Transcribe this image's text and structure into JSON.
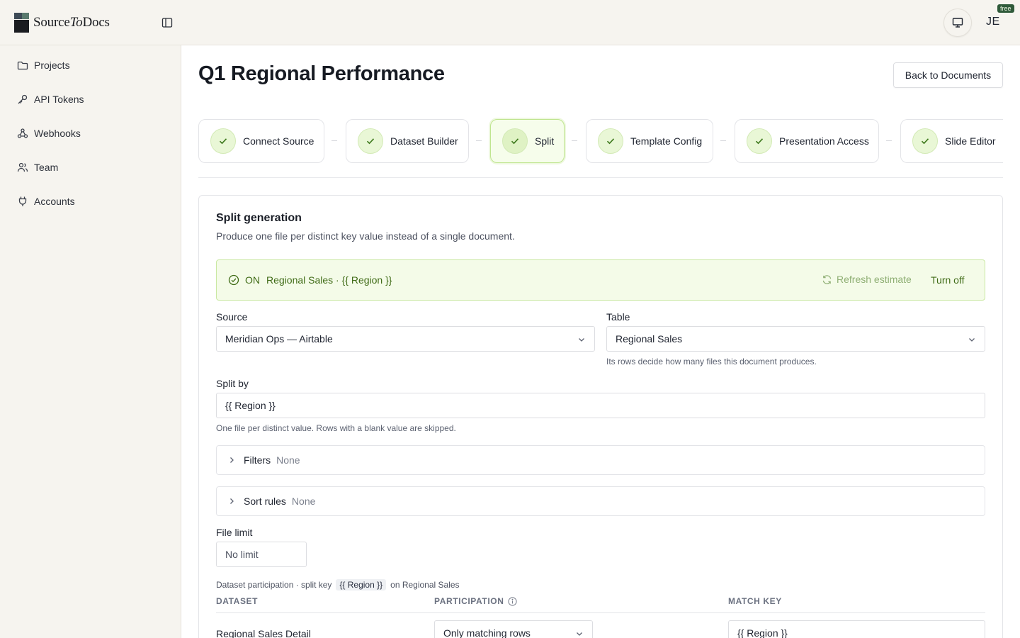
{
  "header": {
    "logo_left": "Source",
    "logo_italic": "To",
    "logo_right": "Docs",
    "avatar_initials": "JE",
    "plan_badge": "free"
  },
  "sidebar": {
    "items": [
      {
        "label": "Projects",
        "icon": "folder-icon"
      },
      {
        "label": "API Tokens",
        "icon": "key-icon"
      },
      {
        "label": "Webhooks",
        "icon": "webhook-icon"
      },
      {
        "label": "Team",
        "icon": "users-icon"
      },
      {
        "label": "Accounts",
        "icon": "plug-icon"
      }
    ]
  },
  "page": {
    "title": "Q1 Regional Performance",
    "back_label": "Back to Documents"
  },
  "steps": [
    {
      "label": "Connect Source",
      "complete": true
    },
    {
      "label": "Dataset Builder",
      "complete": true
    },
    {
      "label": "Split",
      "complete": true,
      "active": true
    },
    {
      "label": "Template Config",
      "complete": true
    },
    {
      "label": "Presentation Access",
      "complete": true
    },
    {
      "label": "Slide Editor",
      "complete": true
    }
  ],
  "split": {
    "title": "Split generation",
    "subtitle": "Produce one file per distinct key value instead of a single document.",
    "status": {
      "state": "ON",
      "summary": "Regional Sales · {{ Region }}",
      "refresh_label": "Refresh estimate",
      "turn_off_label": "Turn off"
    },
    "source": {
      "label": "Source",
      "value": "Meridian Ops — Airtable"
    },
    "table": {
      "label": "Table",
      "value": "Regional Sales",
      "help": "Its rows decide how many files this document produces."
    },
    "split_by": {
      "label": "Split by",
      "value": "{{ Region }}",
      "help": "One file per distinct value. Rows with a blank value are skipped."
    },
    "filters": {
      "label": "Filters",
      "value": "None"
    },
    "sort_rules": {
      "label": "Sort rules",
      "value": "None"
    },
    "file_limit": {
      "label": "File limit",
      "placeholder": "No limit"
    },
    "participation": {
      "caption_prefix": "Dataset participation · split key",
      "key": "{{ Region }}",
      "caption_suffix": "on Regional Sales",
      "columns": [
        "DATASET",
        "PARTICIPATION",
        "MATCH KEY"
      ],
      "rows": [
        {
          "dataset": "Regional Sales Detail",
          "participation": "Only matching rows",
          "match_key": "{{ Region }}"
        }
      ]
    }
  },
  "colors": {
    "accent_green": "#3f6b16",
    "status_bg": "#f4fbe8",
    "status_border": "#c9e8a2",
    "check_bg": "#e9f7d6"
  }
}
